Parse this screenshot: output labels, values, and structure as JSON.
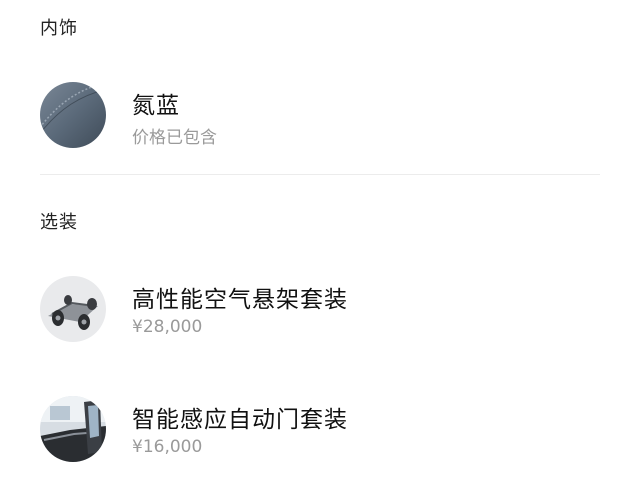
{
  "interior": {
    "section_title": "内饰",
    "item": {
      "name": "氮蓝",
      "subtitle": "价格已包含",
      "swatch_color": "#5b6a7a"
    }
  },
  "options": {
    "section_title": "选装",
    "items": [
      {
        "name": "高性能空气悬架套装",
        "price": "¥28,000",
        "image": "air-suspension-chassis"
      },
      {
        "name": "智能感应自动门套装",
        "price": "¥16,000",
        "image": "automatic-door-interior"
      }
    ]
  }
}
